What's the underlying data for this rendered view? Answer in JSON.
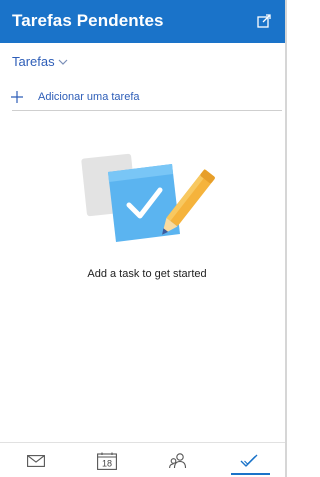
{
  "header": {
    "title": "Tarefas Pendentes",
    "popout_icon": "popout-icon"
  },
  "list_selector": {
    "label": "Tarefas",
    "icon": "chevron-down-icon"
  },
  "add_task": {
    "label": "Adicionar uma tarefa",
    "icon": "plus-icon"
  },
  "empty_state": {
    "message": "Add a task to get started",
    "illustration": "task-checklist-illustration"
  },
  "bottom_nav": {
    "items": [
      {
        "icon": "mail-icon",
        "active": false
      },
      {
        "icon": "calendar-icon",
        "day": "18",
        "active": false
      },
      {
        "icon": "people-icon",
        "active": false
      },
      {
        "icon": "todo-check-icon",
        "active": true
      }
    ]
  },
  "colors": {
    "header_bg": "#1a73c9",
    "accent": "#2e5eb8",
    "divider": "#cfcfcf",
    "illustration_blue": "#5bb4f0",
    "illustration_yellow": "#f5b33c"
  }
}
